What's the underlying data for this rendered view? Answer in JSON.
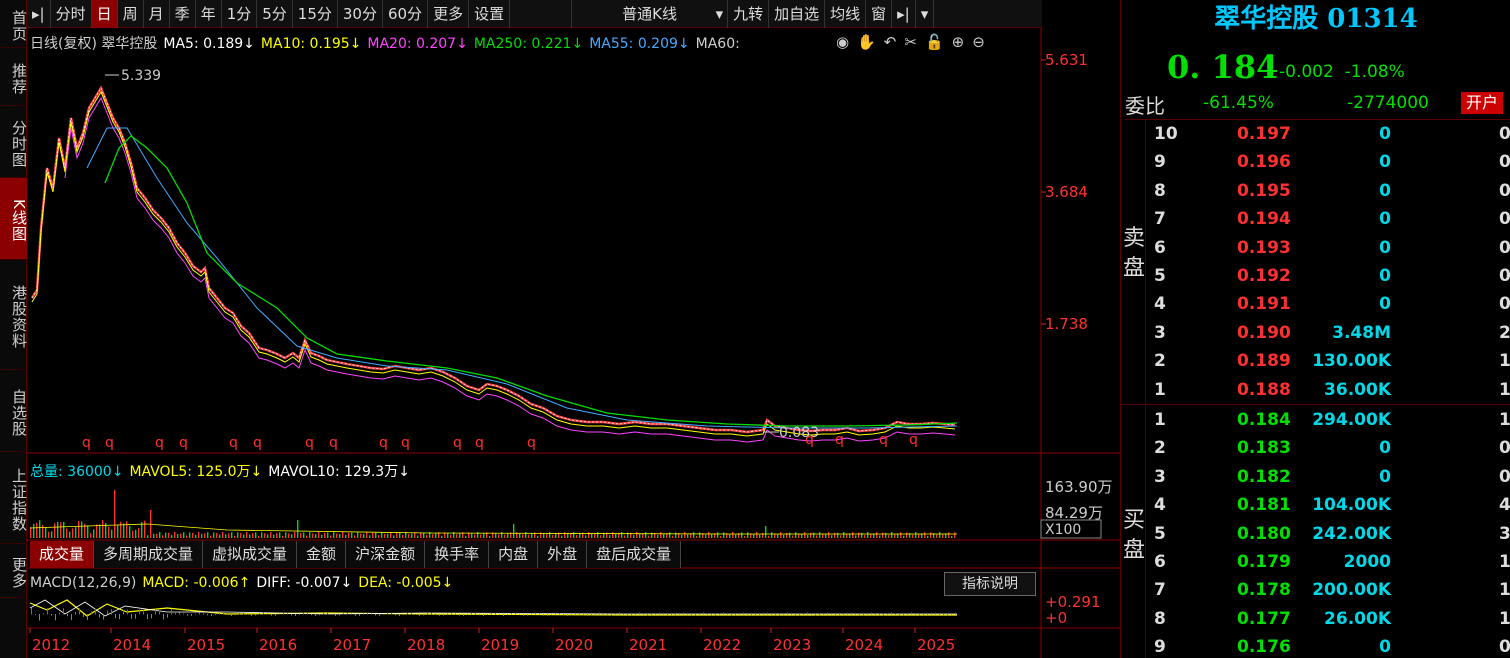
{
  "leftnav": [
    "首页",
    "推荐",
    "分时图",
    "K线图",
    "港股资料",
    "自选股",
    "上证指数",
    "更多"
  ],
  "toolbar": {
    "items": [
      "分时",
      "日",
      "周",
      "月",
      "季",
      "年",
      "1分",
      "5分",
      "15分",
      "30分",
      "60分",
      "更多",
      "设置"
    ],
    "active": "日",
    "select_value": "普通K线",
    "right_items": [
      "九转",
      "加自选",
      "均线",
      "窗"
    ]
  },
  "ma_legend": [
    {
      "text": "日线(复权) 翠华控股",
      "color": "#cfcfcf"
    },
    {
      "text": "MA5: 0.189↓",
      "color": "#ffffff"
    },
    {
      "text": "MA10: 0.195↓",
      "color": "#ffff00"
    },
    {
      "text": "MA20: 0.207↓",
      "color": "#ff44ff"
    },
    {
      "text": "MA250: 0.221↓",
      "color": "#00dd00"
    },
    {
      "text": "MA55: 0.209↓",
      "color": "#44aaff"
    },
    {
      "text": "MA60:",
      "color": "#cfcfcf"
    }
  ],
  "tool_icons": [
    "eye-icon",
    "hand-icon",
    "undo-icon",
    "scissors-icon",
    "lock-icon",
    "zoom-in-icon",
    "zoom-out-icon"
  ],
  "y_axis": [
    "5.631",
    "3.684",
    "1.738"
  ],
  "annotations": {
    "high": "5.339",
    "low": "0.083"
  },
  "markers": "q",
  "volume": {
    "legend": [
      {
        "text": "总量: 36000↓",
        "color": "#00d8e8"
      },
      {
        "text": "MAVOL5: 125.0万↓",
        "color": "#ffff00"
      },
      {
        "text": "MAVOL10: 129.3万↓",
        "color": "#ffffff"
      }
    ],
    "axis": [
      "163.90万",
      "84.29万",
      "X100"
    ]
  },
  "sub_tabs": [
    "成交量",
    "多周期成交量",
    "虚拟成交量",
    "金额",
    "沪深金额",
    "换手率",
    "内盘",
    "外盘",
    "盘后成交量"
  ],
  "macd": {
    "legend": [
      {
        "text": "MACD(12,26,9)",
        "color": "#cfcfcf"
      },
      {
        "text": "MACD: -0.006↑",
        "color": "#ffff00"
      },
      {
        "text": "DIFF: -0.007↓",
        "color": "#ffffff"
      },
      {
        "text": "DEA: -0.005↓",
        "color": "#ffff00"
      }
    ],
    "axis": [
      "+0.291",
      "+0"
    ],
    "button": "指标说明"
  },
  "x_axis": [
    "2012",
    "2014",
    "2015",
    "2016",
    "2017",
    "2018",
    "2019",
    "2020",
    "2021",
    "2022",
    "2023",
    "2024",
    "2025"
  ],
  "stock": {
    "name": "翠华控股 01314",
    "price": "0. 184",
    "change": "-0.002",
    "pct": "-1.08%",
    "ratio_label": "委比",
    "ratio": "-61.45%",
    "diff": "-2774000",
    "open_btn": "开户"
  },
  "sell_label": [
    "卖",
    "盘"
  ],
  "buy_label": [
    "买",
    "盘"
  ],
  "asks": [
    {
      "lv": "10",
      "price": "0.197",
      "vol": "0",
      "cnt": "0"
    },
    {
      "lv": "9",
      "price": "0.196",
      "vol": "0",
      "cnt": "0"
    },
    {
      "lv": "8",
      "price": "0.195",
      "vol": "0",
      "cnt": "0"
    },
    {
      "lv": "7",
      "price": "0.194",
      "vol": "0",
      "cnt": "0"
    },
    {
      "lv": "6",
      "price": "0.193",
      "vol": "0",
      "cnt": "0"
    },
    {
      "lv": "5",
      "price": "0.192",
      "vol": "0",
      "cnt": "0"
    },
    {
      "lv": "4",
      "price": "0.191",
      "vol": "0",
      "cnt": "0"
    },
    {
      "lv": "3",
      "price": "0.190",
      "vol": "3.48M",
      "cnt": "2"
    },
    {
      "lv": "2",
      "price": "0.189",
      "vol": "130.00K",
      "cnt": "1"
    },
    {
      "lv": "1",
      "price": "0.188",
      "vol": "36.00K",
      "cnt": "1"
    }
  ],
  "bids": [
    {
      "lv": "1",
      "price": "0.184",
      "vol": "294.00K",
      "cnt": "1"
    },
    {
      "lv": "2",
      "price": "0.183",
      "vol": "0",
      "cnt": "0"
    },
    {
      "lv": "3",
      "price": "0.182",
      "vol": "0",
      "cnt": "0"
    },
    {
      "lv": "4",
      "price": "0.181",
      "vol": "104.00K",
      "cnt": "4"
    },
    {
      "lv": "5",
      "price": "0.180",
      "vol": "242.00K",
      "cnt": "3"
    },
    {
      "lv": "6",
      "price": "0.179",
      "vol": "2000",
      "cnt": "1"
    },
    {
      "lv": "7",
      "price": "0.178",
      "vol": "200.00K",
      "cnt": "1"
    },
    {
      "lv": "8",
      "price": "0.177",
      "vol": "26.00K",
      "cnt": "1"
    },
    {
      "lv": "9",
      "price": "0.176",
      "vol": "0",
      "cnt": "0"
    }
  ]
}
